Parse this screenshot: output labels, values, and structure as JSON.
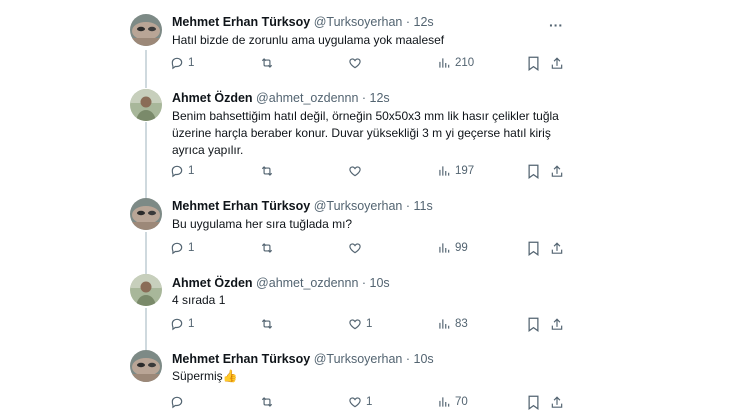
{
  "tweets": [
    {
      "name": "Mehmet Erhan Türksoy",
      "handle": "@Turksoyerhan",
      "time": "12s",
      "text": "Hatıl bizde de zorunlu ama uygulama yok maalesef",
      "replies": "1",
      "retweets": "",
      "likes": "",
      "views": "210"
    },
    {
      "name": "Ahmet Özden",
      "handle": "@ahmet_ozdennn",
      "time": "12s",
      "text": "Benim bahsettiğim hatıl değil, örneğin 50x50x3 mm lik hasır çelikler tuğla üzerine harçla beraber konur. Duvar yüksekliği 3 m yi geçerse hatıl kiriş ayrıca yapılır.",
      "replies": "1",
      "retweets": "",
      "likes": "",
      "views": "197"
    },
    {
      "name": "Mehmet Erhan Türksoy",
      "handle": "@Turksoyerhan",
      "time": "11s",
      "text": "Bu uygulama her sıra tuğlada mı?",
      "replies": "1",
      "retweets": "",
      "likes": "",
      "views": "99"
    },
    {
      "name": "Ahmet Özden",
      "handle": "@ahmet_ozdennn",
      "time": "10s",
      "text": "4 sırada 1",
      "replies": "1",
      "retweets": "",
      "likes": "1",
      "views": "83"
    },
    {
      "name": "Mehmet Erhan Türksoy",
      "handle": "@Turksoyerhan",
      "time": "10s",
      "text": "Süpermiş👍",
      "replies": "",
      "retweets": "",
      "likes": "1",
      "views": "70"
    }
  ],
  "separator": "·",
  "more_glyph": "···",
  "colors": {
    "text": "#0f1419",
    "muted": "#536471",
    "thread": "#cfd9de"
  }
}
